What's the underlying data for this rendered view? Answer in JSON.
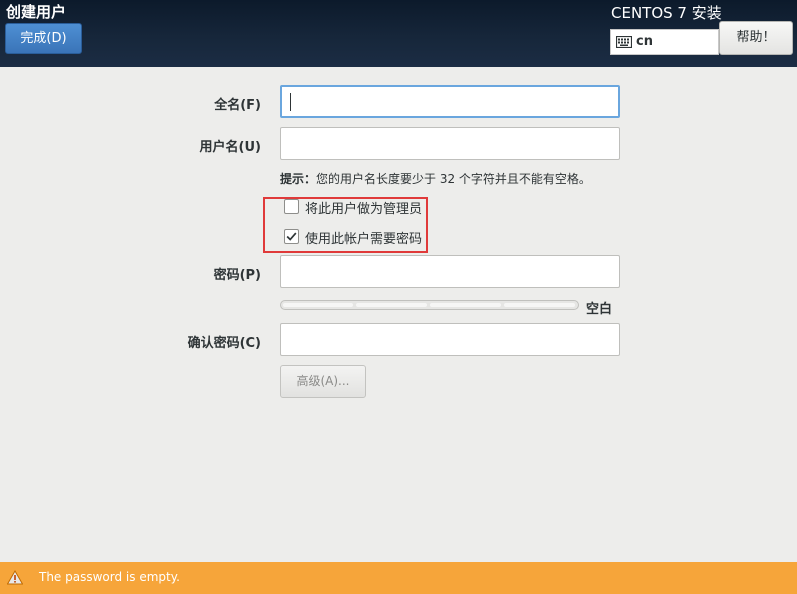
{
  "header": {
    "title": "创建用户",
    "done_label": "完成(D)",
    "install_title": "CENTOS 7 安装",
    "keyboard_layout": "cn",
    "help_label": "帮助！"
  },
  "form": {
    "fullname_label": "全名(F)",
    "fullname_value": "",
    "username_label": "用户名(U)",
    "username_value": "",
    "hint_prefix": "提示：",
    "hint_text": "您的用户名长度要少于 32 个字符并且不能有空格。",
    "admin_checkbox": {
      "label": "将此用户做为管理员",
      "checked": false
    },
    "require_password_checkbox": {
      "label": "使用此帐户需要密码",
      "checked": true
    },
    "password_label": "密码(P)",
    "password_value": "",
    "strength": {
      "label": "空白",
      "level": 0
    },
    "confirm_label": "确认密码(C)",
    "confirm_value": "",
    "advanced_label": "高级(A)..."
  },
  "warning": {
    "text": "The password is empty.",
    "color": "#f6a53a"
  },
  "colors": {
    "header_bg": "#16263a",
    "accent": "#3a74b8",
    "highlight": "#e03a3a"
  }
}
